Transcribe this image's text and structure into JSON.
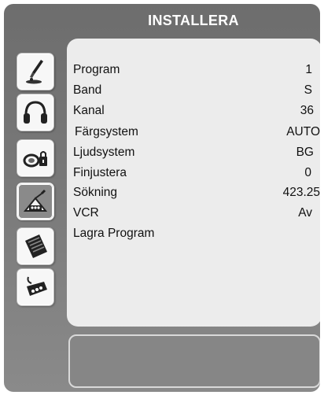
{
  "menu": {
    "title": "INSTALLERA",
    "rows": [
      {
        "label": "Program",
        "value": "1"
      },
      {
        "label": "Band",
        "value": "S"
      },
      {
        "label": "Kanal",
        "value": "36"
      },
      {
        "label": "Färgsystem",
        "value": "AUTO"
      },
      {
        "label": "Ljudsystem",
        "value": "BG"
      },
      {
        "label": "Finjustera",
        "value": "0"
      },
      {
        "label": "Sökning",
        "value": "423.25"
      },
      {
        "label": "VCR",
        "value": "Av"
      },
      {
        "label": "Lagra Program",
        "value": ""
      }
    ]
  },
  "sidebar": {
    "icons": [
      {
        "name": "picture-brush-icon",
        "active": false
      },
      {
        "name": "sound-headphones-icon",
        "active": false
      },
      {
        "name": "features-lock-icon",
        "active": false
      },
      {
        "name": "install-antenna-icon",
        "active": true
      },
      {
        "name": "manual-book-icon",
        "active": false
      },
      {
        "name": "source-connector-icon",
        "active": false
      }
    ]
  },
  "colors": {
    "frame": "#777777",
    "panel": "#ececec",
    "title_text": "#ffffff"
  }
}
